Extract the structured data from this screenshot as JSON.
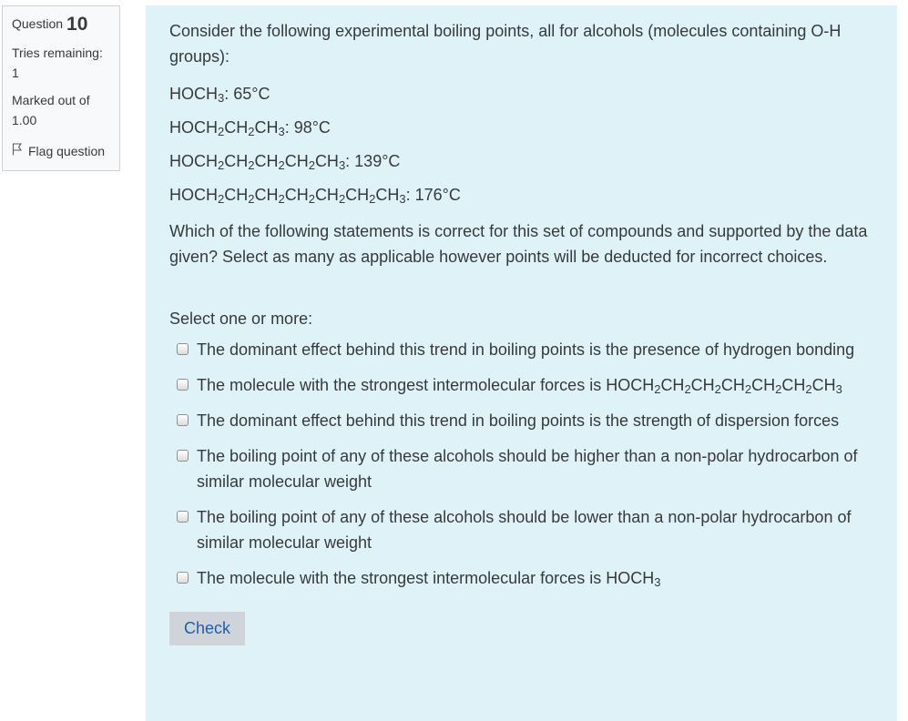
{
  "info": {
    "question_label": "Question",
    "question_number": "10",
    "tries_label": "Tries remaining:",
    "tries_value": "1",
    "marked_label": "Marked out of",
    "marked_value": "1.00",
    "flag_label": "Flag question",
    "flag_icon": "flag-outline-icon"
  },
  "question": {
    "prompt": "Consider the following experimental boiling points, all for alcohols (molecules containing O-H groups):",
    "boiling_points": [
      {
        "formula": [
          "HOCH",
          "3"
        ],
        "value": ": 65°C"
      },
      {
        "formula": [
          "HOCH",
          "2",
          "CH",
          "2",
          "CH",
          "3"
        ],
        "value": ": 98°C"
      },
      {
        "formula": [
          "HOCH",
          "2",
          "CH",
          "2",
          "CH",
          "2",
          "CH",
          "2",
          "CH",
          "3"
        ],
        "value": ": 139°C"
      },
      {
        "formula": [
          "HOCH",
          "2",
          "CH",
          "2",
          "CH",
          "2",
          "CH",
          "2",
          "CH",
          "2",
          "CH",
          "2",
          "CH",
          "3"
        ],
        "value": ": 176°C"
      }
    ],
    "statement": "Which of the following statements is correct for this set of compounds and supported by the data given? Select as many as applicable however points will be deducted for incorrect choices.",
    "select_hint": "Select one or more:",
    "options": [
      {
        "text": "The dominant effect behind this trend in boiling points is the presence of hydrogen bonding"
      },
      {
        "text": "The molecule with the strongest intermolecular forces is ",
        "formula": [
          "HOCH",
          "2",
          "CH",
          "2",
          "CH",
          "2",
          "CH",
          "2",
          "CH",
          "2",
          "CH",
          "2",
          "CH",
          "3"
        ]
      },
      {
        "text": "The dominant effect behind this trend in boiling points is the strength of dispersion forces"
      },
      {
        "text": "The boiling point of any of these alcohols should be higher than a non-polar hydrocarbon of similar molecular weight"
      },
      {
        "text": "The boiling point of any of these alcohols should be lower than a non-polar hydrocarbon of similar molecular weight"
      },
      {
        "text": "The molecule with the strongest intermolecular forces is ",
        "formula": [
          "HOCH",
          "3"
        ]
      }
    ],
    "check_label": "Check"
  }
}
